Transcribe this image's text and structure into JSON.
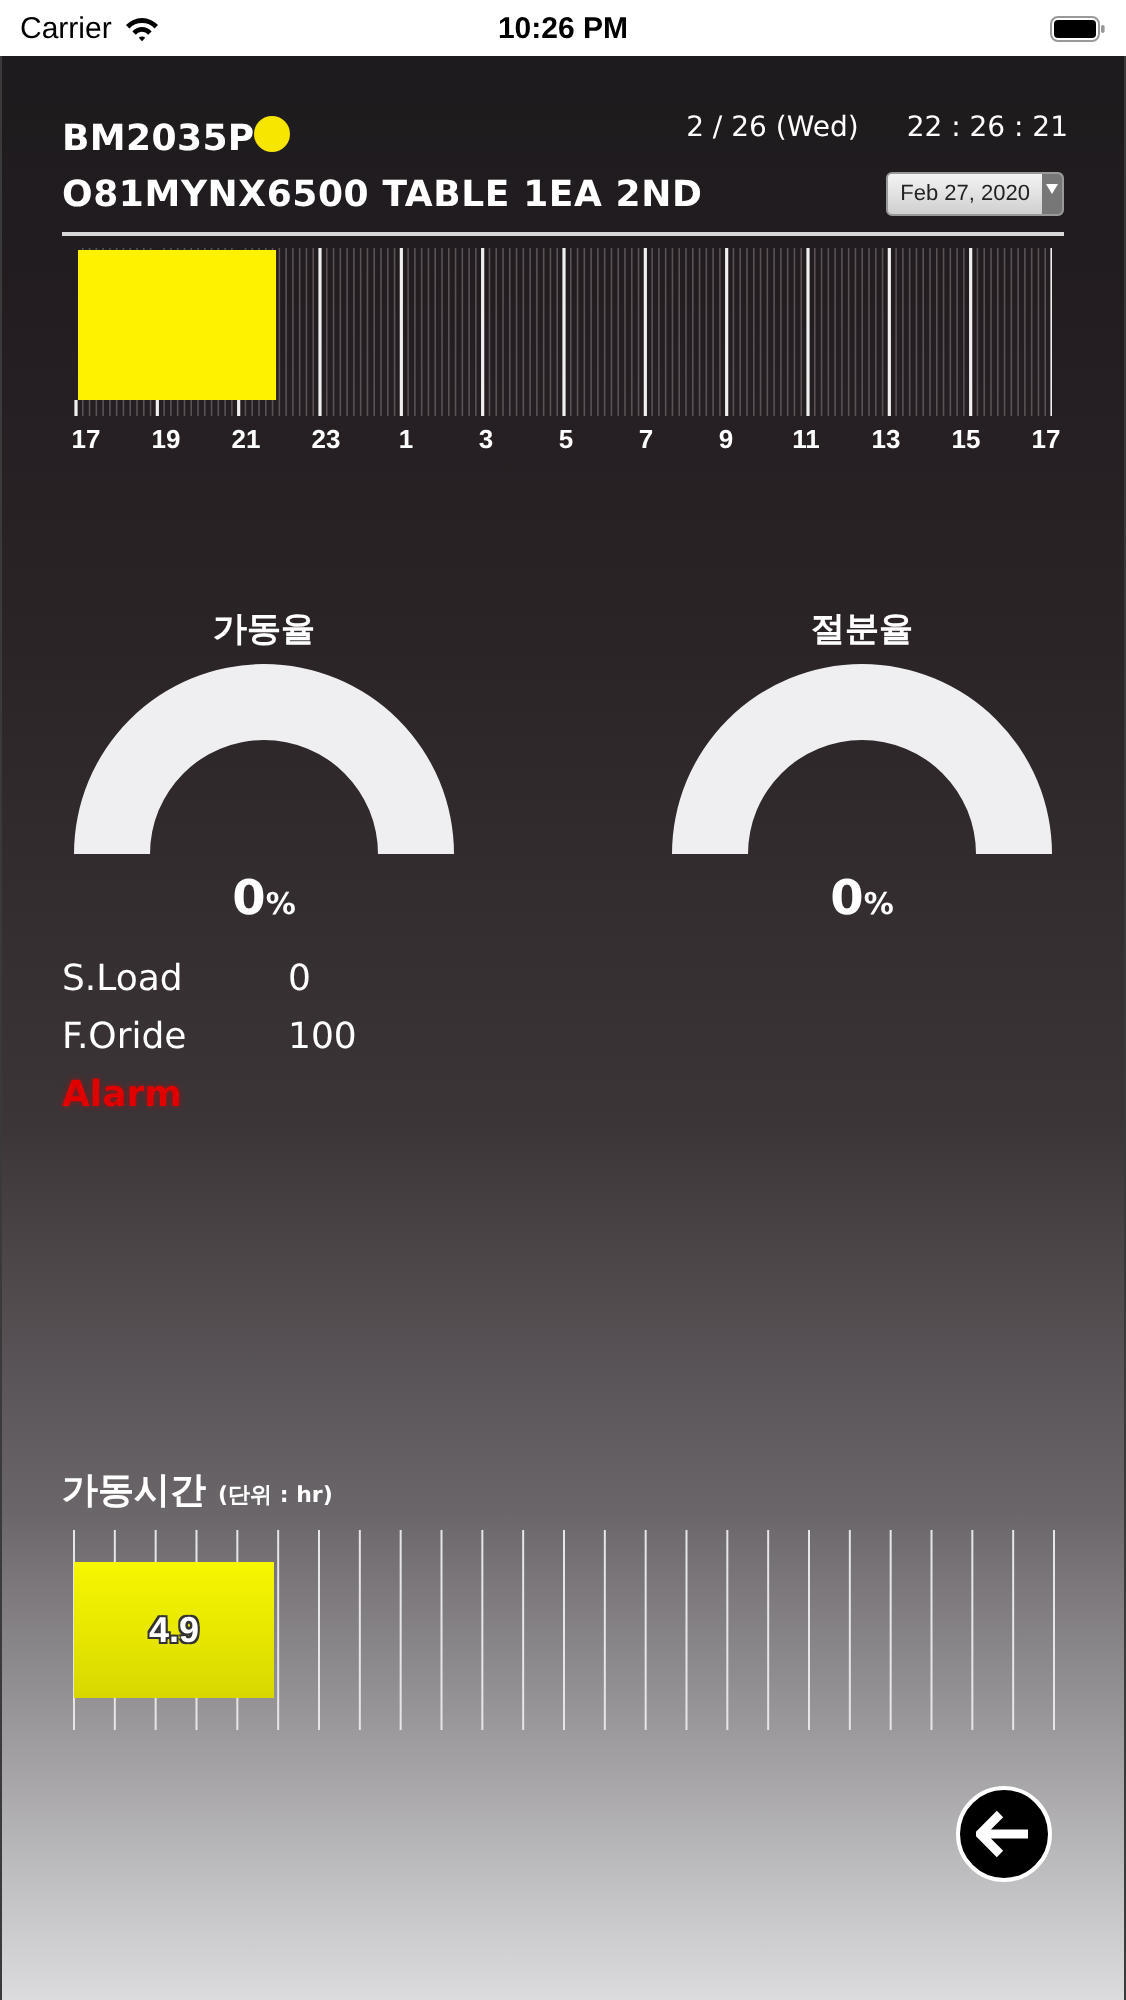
{
  "status_bar": {
    "carrier": "Carrier",
    "time": "10:26 PM"
  },
  "header": {
    "machine": "BM2035P",
    "status": {
      "color": "#f7e600"
    },
    "date": "2 / 26 (Wed)",
    "clock": "22 : 26 : 21",
    "program": "O81MYNX6500 TABLE 1EA 2ND"
  },
  "date_picker": {
    "value": "Feb 27, 2020"
  },
  "timeline": {
    "level": 0.205,
    "hour_labels": [
      "17",
      "19",
      "21",
      "23",
      "1",
      "3",
      "5",
      "7",
      "9",
      "11",
      "13",
      "15",
      "17"
    ]
  },
  "gauges": [
    {
      "title": "가동율",
      "reading": "0",
      "unit": "%"
    },
    {
      "title": "절분율",
      "reading": "0",
      "unit": "%"
    }
  ],
  "readouts": [
    {
      "kind": "value",
      "label": "S.Load",
      "value": "0"
    },
    {
      "kind": "value",
      "label": "F.Oride",
      "value": "100"
    },
    {
      "kind": "alarm",
      "label": "Alarm"
    }
  ],
  "runtime": {
    "title": "가동시간",
    "unit": "(단위 : hr)",
    "level": 0.204,
    "value": "4.9"
  }
}
